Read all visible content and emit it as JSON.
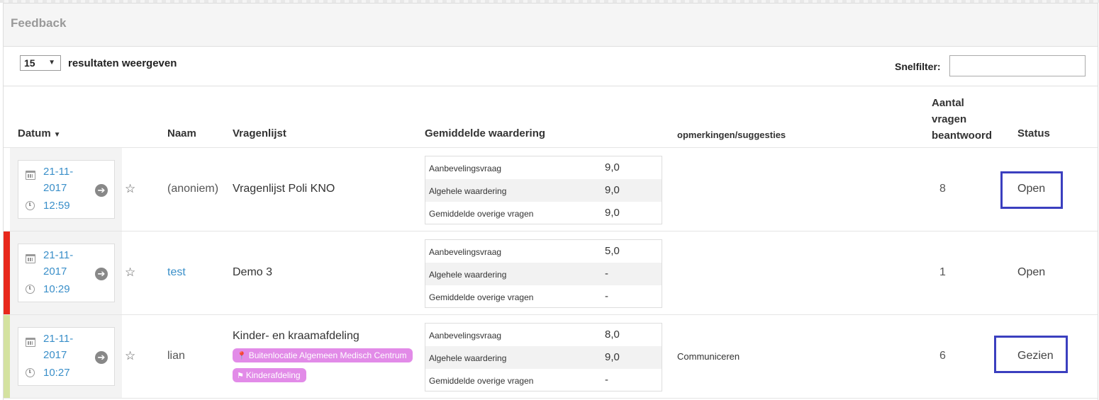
{
  "panel": {
    "title": "Feedback"
  },
  "controls": {
    "page_size": "15",
    "page_size_label": "resultaten weergeven",
    "filter_label": "Snelfilter:",
    "filter_value": ""
  },
  "columns": {
    "date": "Datum",
    "name": "Naam",
    "questionnaire": "Vragenlijst",
    "avg_rating": "Gemiddelde waardering",
    "remarks": "opmerkingen/suggesties",
    "count_line1": "Aantal",
    "count_line2": "vragen",
    "count_line3": "beantwoord",
    "status": "Status"
  },
  "colors": {
    "link": "#3a8fc9",
    "tag": "#e28be8",
    "row_mark_2": "#e8281c",
    "row_mark_3": "#d4e2a0",
    "highlight_box": "#3b3fbf"
  },
  "rows": [
    {
      "date_line1": "21-11-",
      "date_line2": "2017",
      "time": "12:59",
      "name": "(anoniem)",
      "questionnaire": "Vragenlijst Poli KNO",
      "scores": [
        {
          "label": "Aanbevelingsvraag",
          "value": "9,0"
        },
        {
          "label": "Algehele waardering",
          "value": "9,0"
        },
        {
          "label": "Gemiddelde overige vragen",
          "value": "9,0"
        }
      ],
      "remark": "",
      "count": "8",
      "status": "Open"
    },
    {
      "date_line1": "21-11-",
      "date_line2": "2017",
      "time": "10:29",
      "name": "test",
      "questionnaire": "Demo 3",
      "scores": [
        {
          "label": "Aanbevelingsvraag",
          "value": "5,0"
        },
        {
          "label": "Algehele waardering",
          "value": "-"
        },
        {
          "label": "Gemiddelde overige vragen",
          "value": "-"
        }
      ],
      "remark": "",
      "count": "1",
      "status": "Open"
    },
    {
      "date_line1": "21-11-",
      "date_line2": "2017",
      "time": "10:27",
      "name": "lian",
      "questionnaire": "Kinder- en kraamafdeling",
      "tags": [
        "Buitenlocatie Algemeen Medisch Centrum",
        "Kinderafdeling"
      ],
      "scores": [
        {
          "label": "Aanbevelingsvraag",
          "value": "8,0"
        },
        {
          "label": "Algehele waardering",
          "value": "9,0"
        },
        {
          "label": "Gemiddelde overige vragen",
          "value": "-"
        }
      ],
      "remark": "Communiceren",
      "count": "6",
      "status": "Gezien"
    }
  ]
}
